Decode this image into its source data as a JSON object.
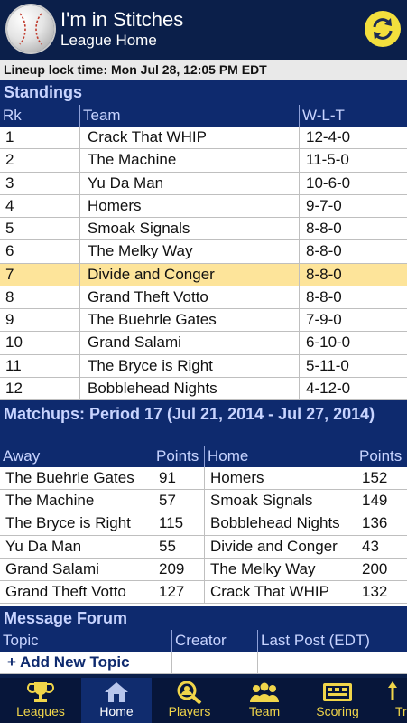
{
  "header": {
    "title": "I'm in Stitches",
    "subtitle": "League Home",
    "logo_icon": "baseball-icon",
    "refresh_icon": "refresh-icon"
  },
  "lock": {
    "label": "Lineup lock time:",
    "value": "Mon Jul 28, 12:05 PM EDT"
  },
  "standings": {
    "title": "Standings",
    "columns": [
      "Rk",
      "Team",
      "W-L-T"
    ],
    "highlight_rank": "7",
    "rows": [
      {
        "rank": "1",
        "team": "Crack That WHIP",
        "record": "12-4-0"
      },
      {
        "rank": "2",
        "team": "The Machine",
        "record": "11-5-0"
      },
      {
        "rank": "3",
        "team": "Yu Da Man",
        "record": "10-6-0"
      },
      {
        "rank": "4",
        "team": "Homers",
        "record": "9-7-0"
      },
      {
        "rank": "5",
        "team": "Smoak Signals",
        "record": "8-8-0"
      },
      {
        "rank": "6",
        "team": "The Melky Way",
        "record": "8-8-0"
      },
      {
        "rank": "7",
        "team": "Divide and Conger",
        "record": "8-8-0"
      },
      {
        "rank": "8",
        "team": "Grand Theft Votto",
        "record": "8-8-0"
      },
      {
        "rank": "9",
        "team": "The Buehrle Gates",
        "record": "7-9-0"
      },
      {
        "rank": "10",
        "team": "Grand Salami",
        "record": "6-10-0"
      },
      {
        "rank": "11",
        "team": "The Bryce is Right",
        "record": "5-11-0"
      },
      {
        "rank": "12",
        "team": "Bobblehead Nights",
        "record": "4-12-0"
      }
    ]
  },
  "matchups": {
    "title": "Matchups: Period 17 (Jul 21, 2014 - Jul 27, 2014)",
    "columns": [
      "Away",
      "Points",
      "Home",
      "Points"
    ],
    "rows": [
      {
        "away": "The Buehrle Gates",
        "away_points": "91",
        "home": "Homers",
        "home_points": "152"
      },
      {
        "away": "The Machine",
        "away_points": "57",
        "home": "Smoak Signals",
        "home_points": "149"
      },
      {
        "away": "The Bryce is Right",
        "away_points": "115",
        "home": "Bobblehead Nights",
        "home_points": "136"
      },
      {
        "away": "Yu Da Man",
        "away_points": "55",
        "home": "Divide and Conger",
        "home_points": "43"
      },
      {
        "away": "Grand Salami",
        "away_points": "209",
        "home": "The Melky Way",
        "home_points": "200"
      },
      {
        "away": "Grand Theft Votto",
        "away_points": "127",
        "home": "Crack That WHIP",
        "home_points": "132"
      }
    ]
  },
  "forum": {
    "title": "Message Forum",
    "columns": [
      "Topic",
      "Creator",
      "Last Post (EDT)"
    ],
    "add_topic": "+ Add New Topic"
  },
  "tabs": [
    {
      "label": "Leagues",
      "icon": "trophy-icon",
      "active": false
    },
    {
      "label": "Home",
      "icon": "home-icon",
      "active": true
    },
    {
      "label": "Players",
      "icon": "player-search-icon",
      "active": false
    },
    {
      "label": "Team",
      "icon": "team-icon",
      "active": false
    },
    {
      "label": "Scoring",
      "icon": "scoreboard-icon",
      "active": false
    },
    {
      "label": "Tr",
      "icon": "trade-icon",
      "active": false
    }
  ],
  "colors": {
    "navy": "#0b1f4a",
    "section": "#0e2a6e",
    "header_text": "#c8d4ff",
    "highlight": "#fde49a",
    "accent_yellow": "#f0d54a"
  }
}
